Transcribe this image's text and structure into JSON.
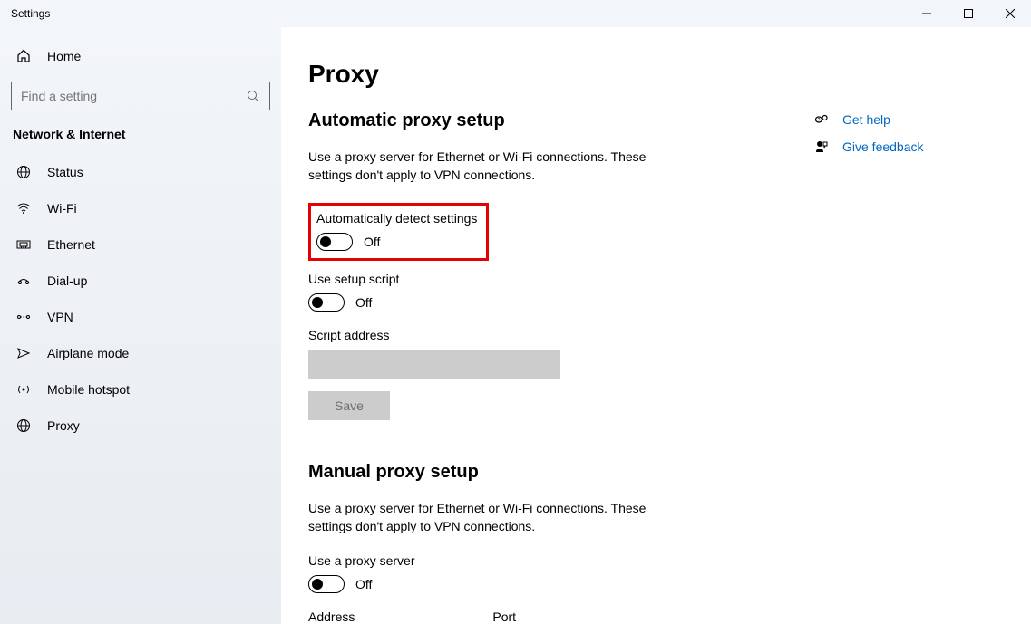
{
  "window": {
    "title": "Settings"
  },
  "sidebar": {
    "home": "Home",
    "search_placeholder": "Find a setting",
    "category": "Network & Internet",
    "items": [
      {
        "label": "Status"
      },
      {
        "label": "Wi-Fi"
      },
      {
        "label": "Ethernet"
      },
      {
        "label": "Dial-up"
      },
      {
        "label": "VPN"
      },
      {
        "label": "Airplane mode"
      },
      {
        "label": "Mobile hotspot"
      },
      {
        "label": "Proxy"
      }
    ]
  },
  "page": {
    "title": "Proxy",
    "auto": {
      "heading": "Automatic proxy setup",
      "desc": "Use a proxy server for Ethernet or Wi-Fi connections. These settings don't apply to VPN connections.",
      "detect_label": "Automatically detect settings",
      "detect_state": "Off",
      "script_label": "Use setup script",
      "script_state": "Off",
      "address_label": "Script address",
      "address_value": "",
      "save": "Save"
    },
    "manual": {
      "heading": "Manual proxy setup",
      "desc": "Use a proxy server for Ethernet or Wi-Fi connections. These settings don't apply to VPN connections.",
      "use_label": "Use a proxy server",
      "use_state": "Off",
      "address_label": "Address",
      "port_label": "Port"
    }
  },
  "aside": {
    "help": "Get help",
    "feedback": "Give feedback"
  }
}
